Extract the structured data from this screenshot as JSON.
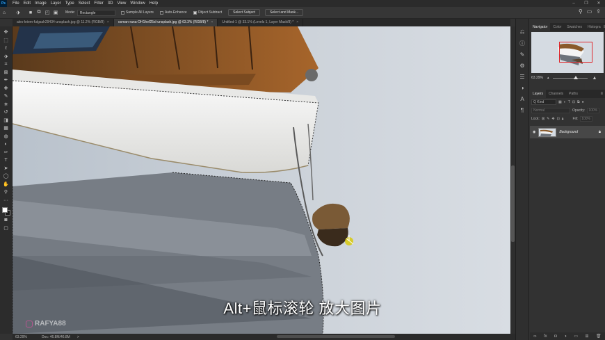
{
  "app": {
    "logo": "Ps"
  },
  "menu": [
    "File",
    "Edit",
    "Image",
    "Layer",
    "Type",
    "Select",
    "Filter",
    "3D",
    "View",
    "Window",
    "Help"
  ],
  "window_controls": {
    "minimize": "–",
    "restore": "❐",
    "close": "✕"
  },
  "options_bar": {
    "mode_label": "Mode:",
    "mode_value": "Rectangle",
    "sample_all_layers": "Sample All Layers",
    "auto_enhance": "Auto-Enhance",
    "object_subtract": "Object Subtract",
    "select_subject": "Select Subject",
    "select_and_mask": "Select and Mask..."
  },
  "doc_tabs": [
    {
      "label": "alex-kriem-fulgsah29434-unsplash.jpg @ 11.2% (RGB/8)",
      "active": false
    },
    {
      "label": "osman-rana-OH1hef25sl-unsplash.jpg @ 63.3% (RGB/8) *",
      "active": true
    },
    {
      "label": "Untitled-1 @ 33.1% (Levels 1, Layer Mask/8) *",
      "active": false
    }
  ],
  "tools": [
    "move-tool",
    "marquee-tool",
    "lasso-tool",
    "object-select-tool",
    "crop-tool",
    "frame-tool",
    "eyedropper-tool",
    "healing-tool",
    "brush-tool",
    "clone-stamp-tool",
    "history-brush-tool",
    "eraser-tool",
    "gradient-tool",
    "blur-tool",
    "dodge-tool",
    "pen-tool",
    "type-tool",
    "path-select-tool",
    "shape-tool",
    "hand-tool",
    "zoom-tool",
    "more-tools"
  ],
  "tool_glyphs": [
    "✥",
    "⬚",
    "ℓ",
    "⬗",
    "⌗",
    "⊠",
    "✒",
    "✚",
    "✎",
    "⎈",
    "↺",
    "◨",
    "▦",
    "◍",
    "◐",
    "✑",
    "T",
    "➤",
    "◯",
    "✋",
    "⚲",
    "···"
  ],
  "colors": {
    "foreground": "#ffffff",
    "background": "#1a1a1a",
    "selection_marker": "#e0262b"
  },
  "caption": "Alt+鼠标滚轮  放大图片",
  "watermark": "RAFYA88",
  "status": {
    "zoom": "63.29%",
    "doc": "Doc: 46.8M/46.8M",
    "arrow": ">"
  },
  "navigator": {
    "tabs": [
      "Navigator",
      "Color",
      "Swatches",
      "Histogra"
    ],
    "zoom": "63.29%"
  },
  "layers": {
    "tabs": [
      "Layers",
      "Channels",
      "Paths"
    ],
    "kind_placeholder": "Q Kind",
    "blend_mode": "Normal",
    "opacity_label": "Opacity:",
    "opacity_value": "100%",
    "lock_label": "Lock:",
    "fill_label": "Fill:",
    "fill_value": "100%",
    "items": [
      {
        "name": "Background",
        "visible": true,
        "locked": true
      }
    ]
  }
}
